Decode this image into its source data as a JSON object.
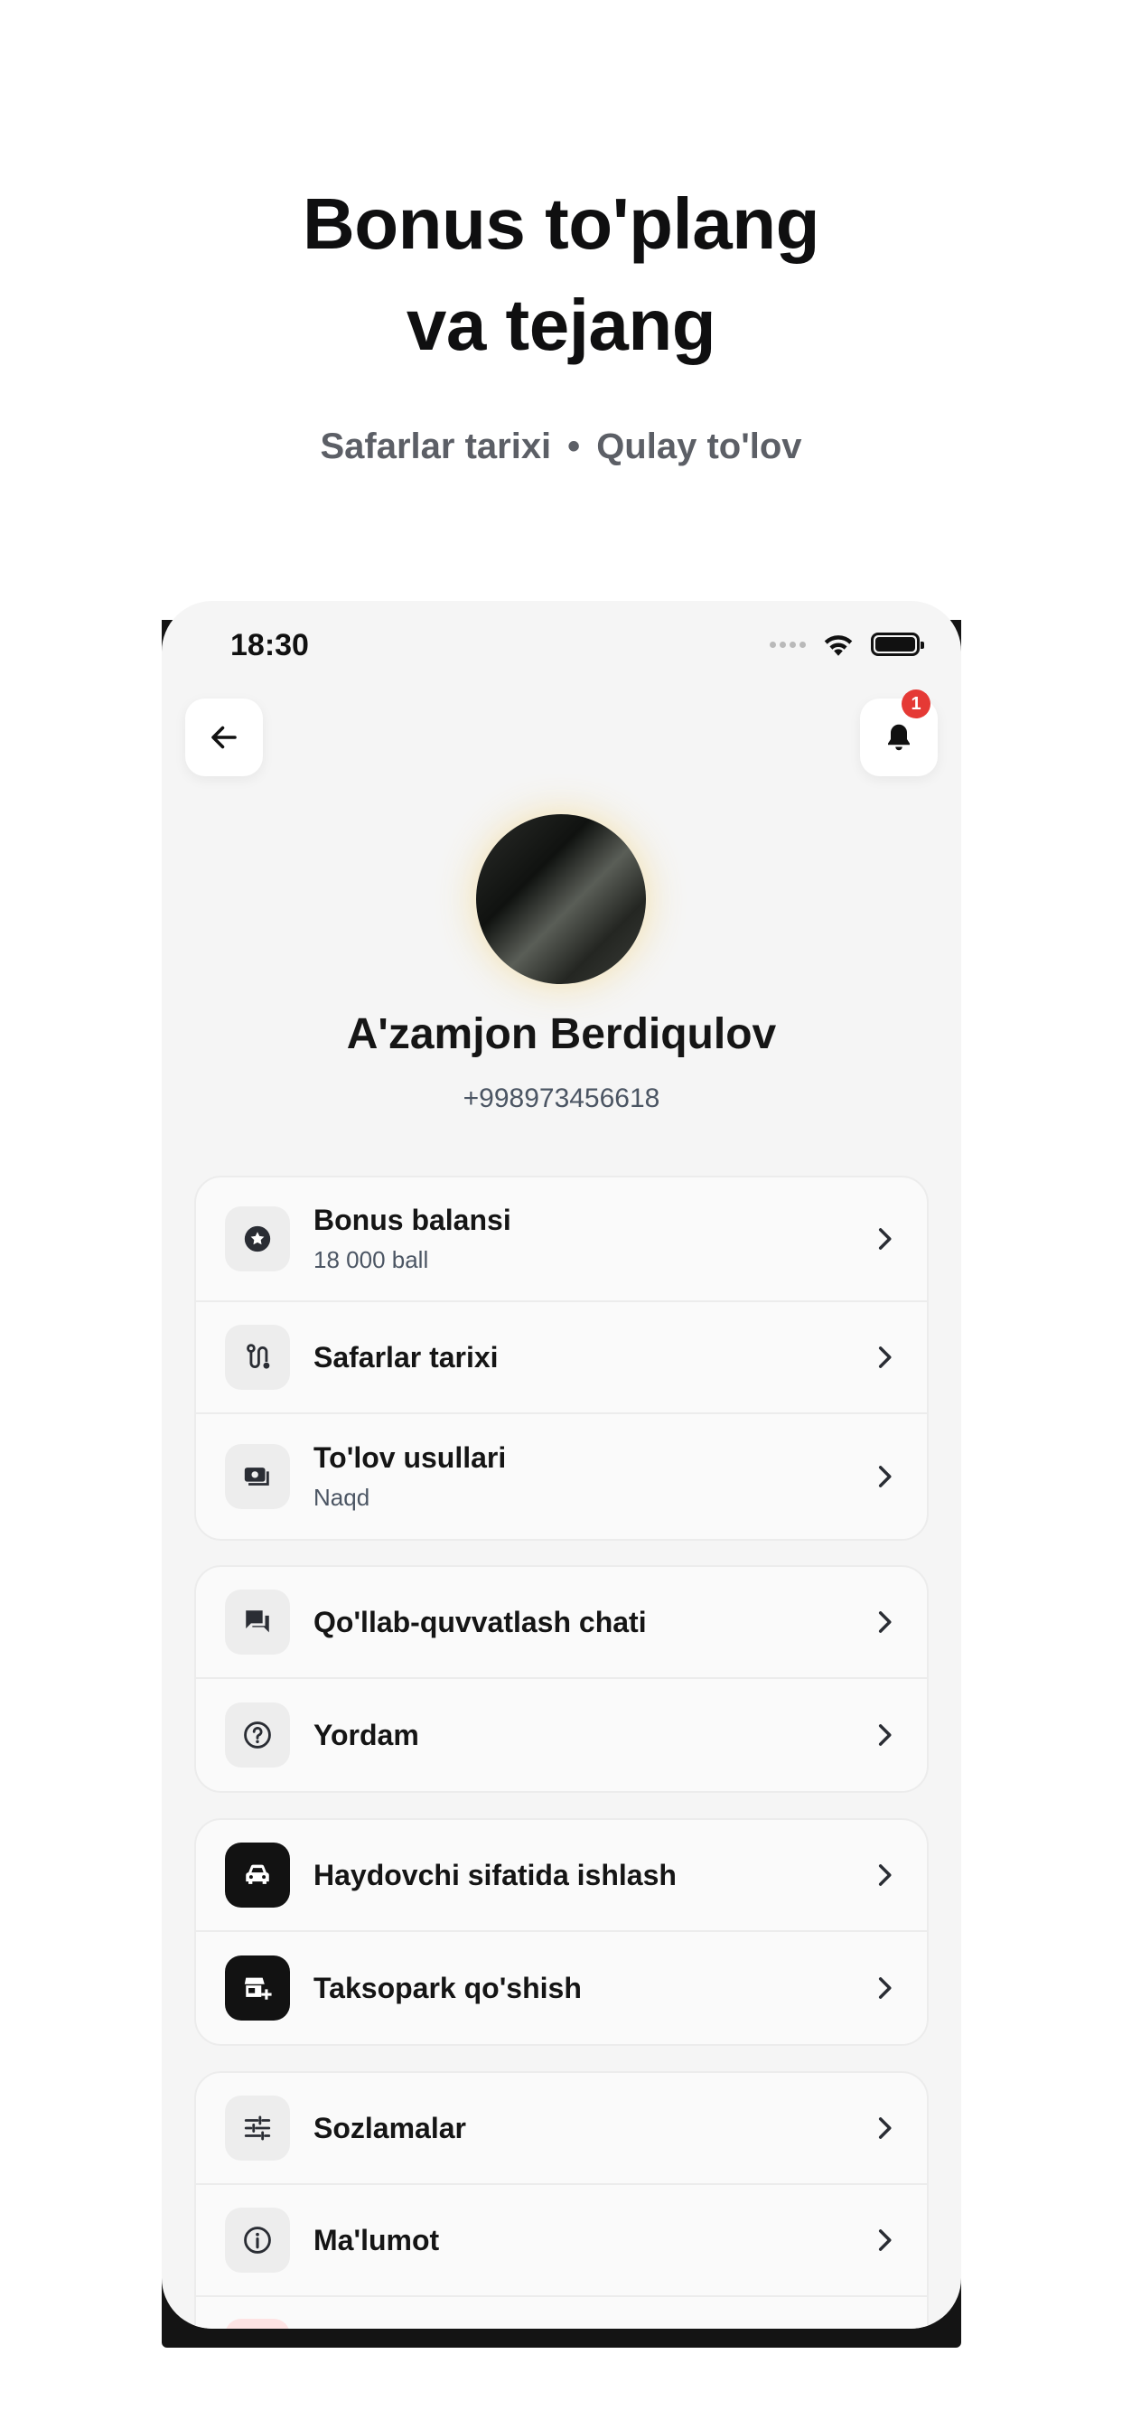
{
  "hero": {
    "title_line1": "Bonus to'plang",
    "title_line2": "va tejang",
    "sub_left": "Safarlar tarixi",
    "sub_sep": "•",
    "sub_right": "Qulay to'lov"
  },
  "status_bar": {
    "time": "18:30"
  },
  "header": {
    "notification_count": "1"
  },
  "profile": {
    "name": "A'zamjon Berdiqulov",
    "phone": "+998973456618"
  },
  "menu": {
    "group1": [
      {
        "title": "Bonus balansi",
        "subtitle": "18 000 ball",
        "icon": "star-badge-icon"
      },
      {
        "title": "Safarlar tarixi",
        "icon": "route-icon"
      },
      {
        "title": "To'lov usullari",
        "subtitle": "Naqd",
        "icon": "cash-icon"
      }
    ],
    "group2": [
      {
        "title": "Qo'llab-quvvatlash chati",
        "icon": "chat-icon"
      },
      {
        "title": "Yordam",
        "icon": "help-icon"
      }
    ],
    "group3": [
      {
        "title": "Haydovchi sifatida ishlash",
        "icon": "car-icon"
      },
      {
        "title": "Taksopark qo'shish",
        "icon": "taxi-park-add-icon"
      }
    ],
    "group4": [
      {
        "title": "Sozlamalar",
        "icon": "sliders-icon"
      },
      {
        "title": "Ma'lumot",
        "icon": "info-icon"
      }
    ]
  },
  "colors": {
    "badge": "#e53935",
    "accent_dark": "#121212",
    "background": "#f5f5f5"
  }
}
